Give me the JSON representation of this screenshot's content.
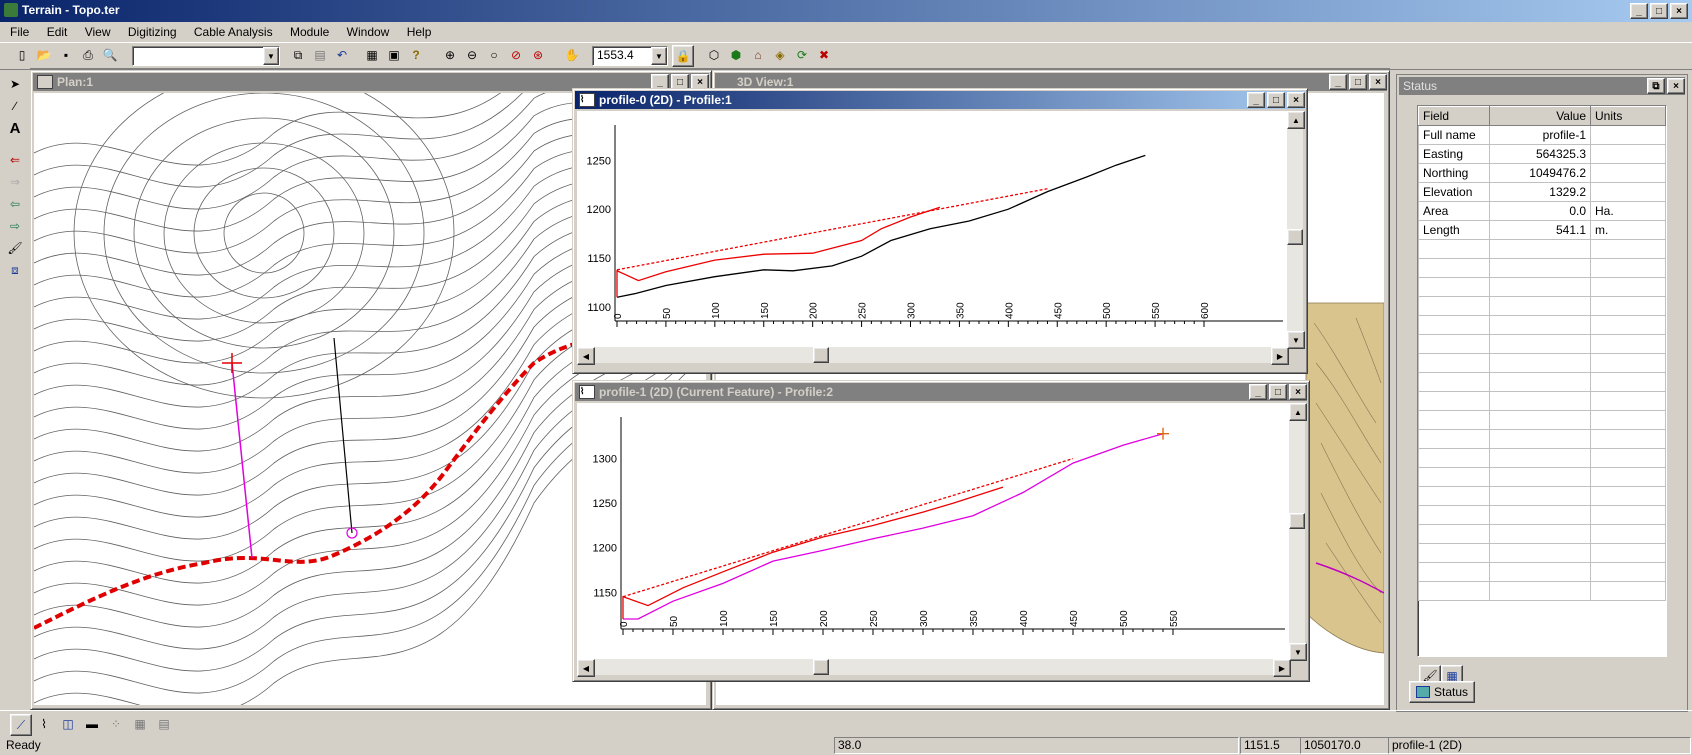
{
  "app": {
    "title": "Terrain - Topo.ter"
  },
  "menu": [
    "File",
    "Edit",
    "View",
    "Digitizing",
    "Cable Analysis",
    "Module",
    "Window",
    "Help"
  ],
  "toolbar": {
    "elevation_value": "1553.4"
  },
  "windows": {
    "plan": {
      "title": "Plan:1"
    },
    "view3d": {
      "title": "3D View:1"
    },
    "profile0": {
      "title": "profile-0 (2D) - Profile:1"
    },
    "profile1": {
      "title": "profile-1 (2D) (Current Feature) - Profile:2"
    }
  },
  "profile0_chart": {
    "type": "line",
    "y_ticks": [
      "1250",
      "1200",
      "1150",
      "1100"
    ],
    "x_ticks": [
      "0",
      "50",
      "100",
      "150",
      "200",
      "250",
      "300",
      "350",
      "400",
      "450",
      "500",
      "550",
      "600"
    ]
  },
  "profile1_chart": {
    "type": "line",
    "y_ticks": [
      "1300",
      "1250",
      "1200",
      "1150"
    ],
    "x_ticks": [
      "0",
      "50",
      "100",
      "150",
      "200",
      "250",
      "300",
      "350",
      "400",
      "450",
      "500",
      "550"
    ]
  },
  "status_panel": {
    "title": "Status",
    "headers": [
      "Field",
      "Value",
      "Units"
    ],
    "rows": [
      [
        "Full name",
        "profile-1",
        ""
      ],
      [
        "Easting",
        "564325.3",
        ""
      ],
      [
        "Northing",
        "1049476.2",
        ""
      ],
      [
        "Elevation",
        "1329.2",
        ""
      ],
      [
        "Area",
        "0.0",
        "Ha."
      ],
      [
        "Length",
        "541.1",
        "m."
      ]
    ],
    "tab_label": "Status"
  },
  "statusbar": {
    "ready": "Ready",
    "c1": "38.0",
    "c2": "1151.5",
    "c3": "1050170.0",
    "c4": "profile-1 (2D)"
  }
}
